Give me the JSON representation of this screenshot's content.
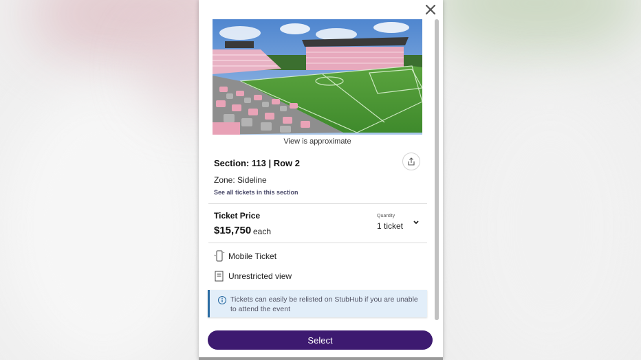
{
  "modal": {
    "close_icon": "close-icon",
    "image_caption": "View is approximate",
    "section_row": "Section: 113 | Row 2",
    "share_icon": "share-icon",
    "zone_value": "Zone: Sideline",
    "see_all_link": "See all tickets in this section",
    "price": {
      "label": "Ticket Price",
      "value": "$15,750",
      "suffix": "each"
    },
    "quantity": {
      "label": "Quantity",
      "value": "1 ticket",
      "icon": "chevron-down-icon"
    },
    "features": [
      {
        "icon": "mobile-phone-icon",
        "label": "Mobile Ticket"
      },
      {
        "icon": "document-icon",
        "label": "Unrestricted view"
      }
    ],
    "notice": {
      "icon": "info-icon",
      "text": "Tickets can easily be relisted on StubHub if you are unable to attend the event"
    },
    "select_button": "Select"
  },
  "colors": {
    "button_bg": "#3d1a70",
    "notice_bg": "#e2eef9",
    "notice_border": "#2b6ca3",
    "field_green": "#4f9a3a",
    "seat_pink": "#e7a9bd"
  }
}
